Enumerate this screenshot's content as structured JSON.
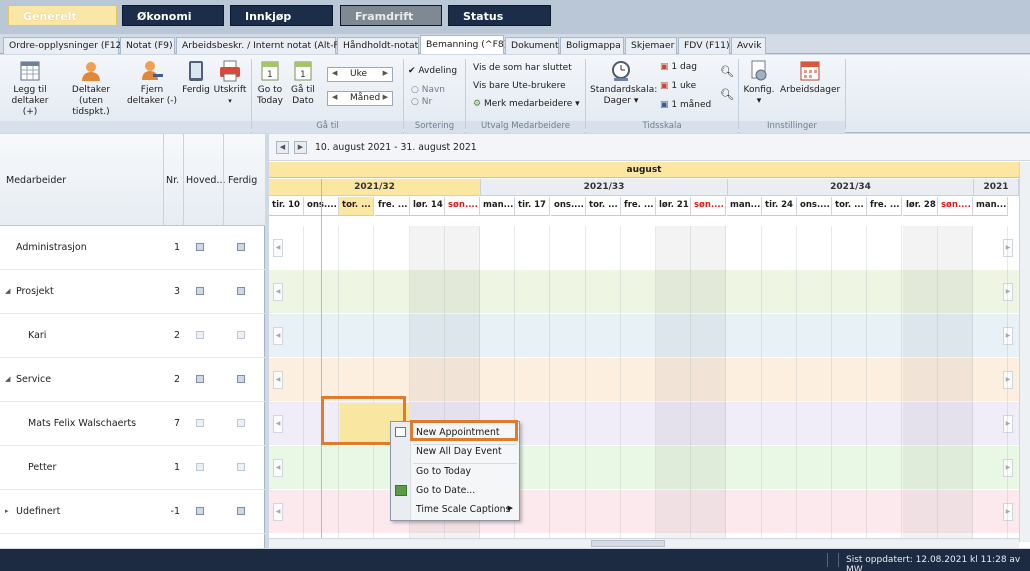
{
  "modules": [
    "Generelt",
    "Økonomi",
    "Innkjøp",
    "Framdrift",
    "Status"
  ],
  "tabs": [
    "Ordre-opplysninger (F12)",
    "Notat (F9)",
    "Arbeidsbeskr. / Internt notat (Alt-F9)",
    "Håndholdt-notat",
    "Bemanning (^F8)",
    "Dokument",
    "Boligmappa",
    "Skjemaer",
    "FDV (F11)",
    "Avvik"
  ],
  "ribbon": {
    "add_participant": "Legg til deltaker (+)",
    "participant_no_time": "Deltaker (uten tidspkt.)",
    "remove_participant": "Fjern deltaker (-)",
    "done": "Ferdig",
    "print": "Utskrift",
    "go_today": "Go to Today",
    "go_date": "Gå til Dato",
    "week_spin": "Uke",
    "month_spin": "Måned",
    "dept": "Avdeling",
    "name": "Navn",
    "nr": "Nr",
    "show_finished": "Vis de som har sluttet",
    "show_outside": "Vis bare Ute-brukere",
    "select_employees": "Merk medarbeidere ▾",
    "std_scale": "Standardskala: Dager ▾",
    "day1": "1 dag",
    "week1": "1 uke",
    "month1": "1 måned",
    "config": "Konfig. ▾",
    "workdays": "Arbeidsdager",
    "group_goto": "Gå til",
    "group_sort": "Sortering",
    "group_select": "Utvalg Medarbeidere",
    "group_timescale": "Tidsskala",
    "group_settings": "Innstillinger"
  },
  "left": {
    "col_employee": "Medarbeider",
    "col_nr": "Nr.",
    "col_main": "Hoved...",
    "col_done": "Ferdig",
    "rows": [
      {
        "name": "Administrasjon",
        "nr": "1"
      },
      {
        "name": "Prosjekt",
        "nr": "3"
      },
      {
        "name": "Kari",
        "nr": "2"
      },
      {
        "name": "Service",
        "nr": "2"
      },
      {
        "name": "Mats Felix Walschaerts",
        "nr": "7"
      },
      {
        "name": "Petter",
        "nr": "1"
      },
      {
        "name": "Udefinert",
        "nr": "-1"
      }
    ]
  },
  "calendar": {
    "range": "10. august 2021 - 31. august 2021",
    "month": "august",
    "weeks": [
      "2021/32",
      "2021/33",
      "2021/34",
      "2021"
    ],
    "days": [
      "tir. 10",
      "ons....",
      "tor. ...",
      "fre. ...",
      "lør. 14",
      "søn....",
      "man...",
      "tir. 17",
      "ons....",
      "tor. ...",
      "fre. ...",
      "lør. 21",
      "søn....",
      "man...",
      "tir. 24",
      "ons....",
      "tor. ...",
      "fre. ...",
      "lør. 28",
      "søn....",
      "man..."
    ],
    "row_colors": [
      "#ffffff",
      "#eef5e3",
      "#e7f1f6",
      "#fdefe0",
      "#f0ecf8",
      "#e9f8e4",
      "#fce9ee"
    ]
  },
  "context_menu": [
    "New Appointment",
    "New All Day Event",
    "Go to Today",
    "Go to Date...",
    "Time Scale Captions"
  ],
  "status": "Sist oppdatert: 12.08.2021 kl 11:28 av MW",
  "accent": "#e07a2c"
}
